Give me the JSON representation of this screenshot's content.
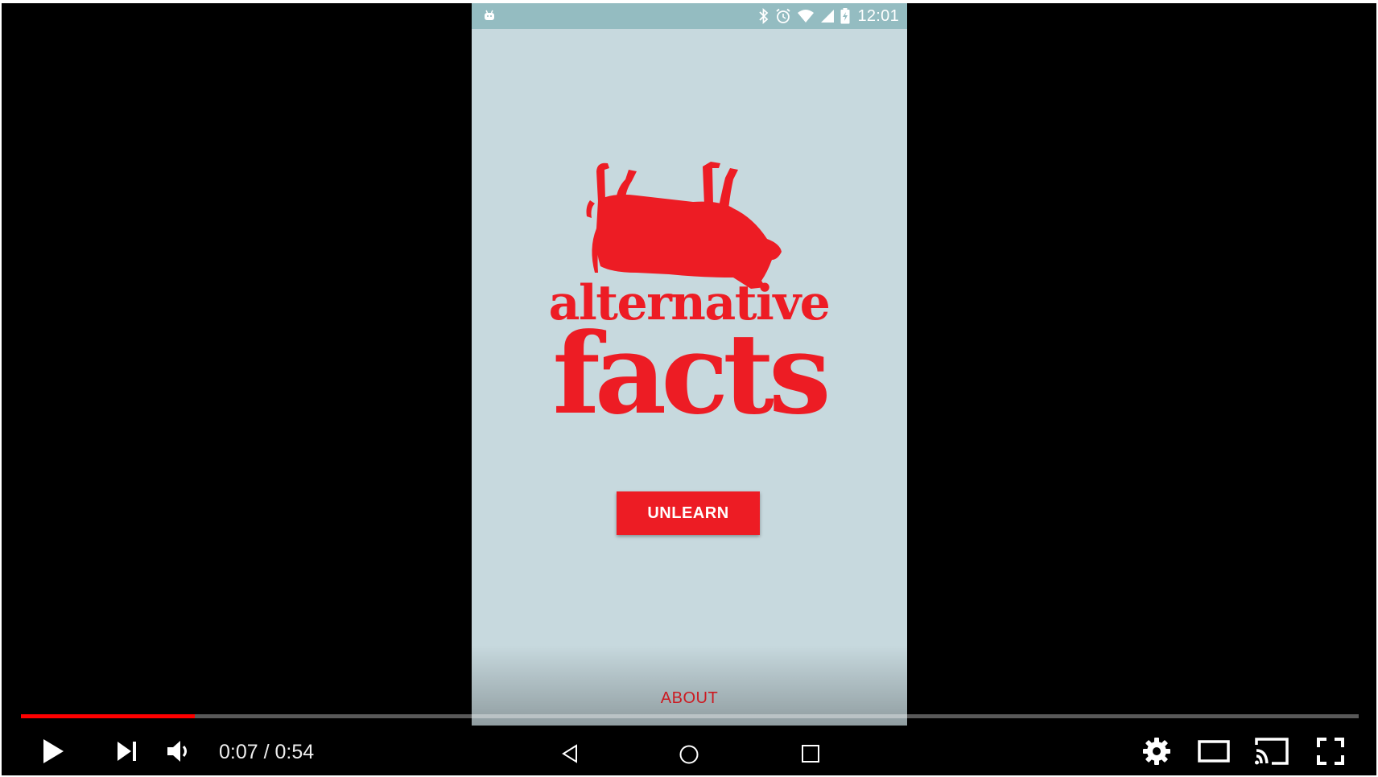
{
  "phone": {
    "status_bar": {
      "time": "12:01",
      "icons": [
        "android-debug-icon",
        "bluetooth-icon",
        "alarm-icon",
        "wifi-icon",
        "cell-signal-icon",
        "battery-charging-icon"
      ]
    },
    "logo": {
      "line1": "alternative",
      "line2": "facts",
      "image": "upside-down-cow"
    },
    "unlearn_label": "UNLEARN",
    "about_label": "ABOUT",
    "nav_icons": [
      "back-icon",
      "home-icon",
      "recents-icon"
    ]
  },
  "player": {
    "current_time": "0:07",
    "duration": "0:54",
    "time_display": "0:07 / 0:54",
    "progress_fraction": 0.13,
    "controls_left": [
      "play-icon",
      "next-icon",
      "volume-icon"
    ],
    "controls_right": [
      "settings-icon",
      "theater-mode-icon",
      "cast-icon",
      "fullscreen-icon"
    ]
  },
  "colors": {
    "brand_red": "#ed1c24",
    "phone_background": "#c7d9de",
    "status_bar": "#94bcc1",
    "progress": "#ff0000",
    "player_background": "#000000"
  }
}
